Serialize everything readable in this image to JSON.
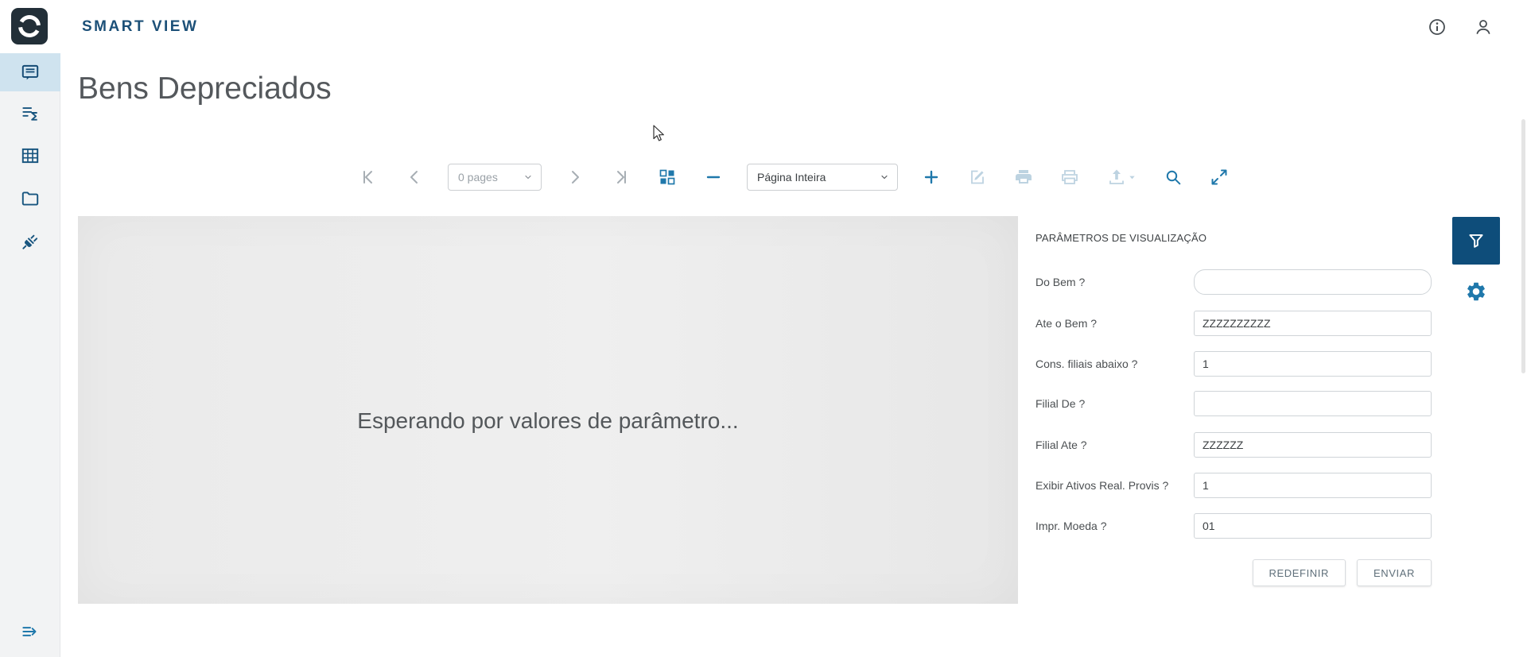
{
  "header": {
    "app_title": "SMART VIEW"
  },
  "page": {
    "title": "Bens Depreciados"
  },
  "toolbar": {
    "pages_select": "0 pages",
    "zoom_select": "Página Inteira"
  },
  "viewer": {
    "message": "Esperando por valores de parâmetro..."
  },
  "params": {
    "title": "PARÂMETROS DE VISUALIZAÇÃO",
    "fields": [
      {
        "label": "Do Bem ?",
        "value": ""
      },
      {
        "label": "Ate o Bem ?",
        "value": "ZZZZZZZZZZ"
      },
      {
        "label": "Cons. filiais abaixo ?",
        "value": "1"
      },
      {
        "label": "Filial De ?",
        "value": ""
      },
      {
        "label": "Filial Ate ?",
        "value": "ZZZZZZ"
      },
      {
        "label": "Exibir Ativos Real. Provis ?",
        "value": "1"
      },
      {
        "label": "Impr. Moeda ?",
        "value": "01"
      }
    ],
    "buttons": {
      "reset": "REDEFINIR",
      "submit": "ENVIAR"
    }
  },
  "icons": {
    "header": [
      "info-icon",
      "user-icon"
    ],
    "sidebar": [
      "report-icon",
      "summary-icon",
      "table-icon",
      "folder-icon",
      "plug-icon",
      "expand-menu-icon"
    ],
    "toolbar": [
      "first-page-icon",
      "previous-page-icon",
      "next-page-icon",
      "last-page-icon",
      "page-layout-icon",
      "zoom-out-icon",
      "zoom-in-icon",
      "edit-report-icon",
      "print-icon",
      "print-preview-icon",
      "export-icon",
      "search-icon",
      "fullscreen-icon"
    ],
    "panel": [
      "filter-icon",
      "gear-icon"
    ]
  },
  "colors": {
    "brand_text": "#1c5078",
    "accent_blue": "#1f78ab",
    "filter_button_bg": "#0e4d7a",
    "active_item_bg": "#cfe3ef",
    "disabled_icon": "#bdd3e1",
    "viewer_bg": "#ececec"
  }
}
